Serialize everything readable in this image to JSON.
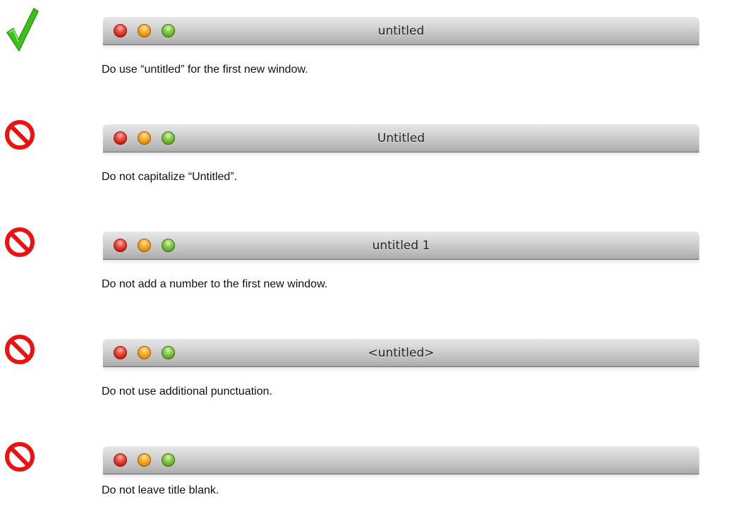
{
  "examples": [
    {
      "verdict": "correct",
      "verdict_icon": "green-checkmark-icon",
      "window_title": "untitled",
      "caption": "Do use “untitled” for the first new window."
    },
    {
      "verdict": "incorrect",
      "verdict_icon": "prohibited-icon",
      "window_title": "Untitled",
      "caption": "Do not capitalize “Untitled”."
    },
    {
      "verdict": "incorrect",
      "verdict_icon": "prohibited-icon",
      "window_title": "untitled 1",
      "caption": "Do not add a number to the first new window."
    },
    {
      "verdict": "incorrect",
      "verdict_icon": "prohibited-icon",
      "window_title": "<untitled>",
      "caption": "Do not use additional punctuation."
    },
    {
      "verdict": "incorrect",
      "verdict_icon": "prohibited-icon",
      "window_title": "",
      "caption": "Do not leave title blank."
    }
  ],
  "colors": {
    "check_green": "#3fbf1f",
    "prohibit_red": "#ee1111",
    "close_button": "#e0392b",
    "minimize_button": "#f0a020",
    "zoom_button": "#79c03c"
  }
}
